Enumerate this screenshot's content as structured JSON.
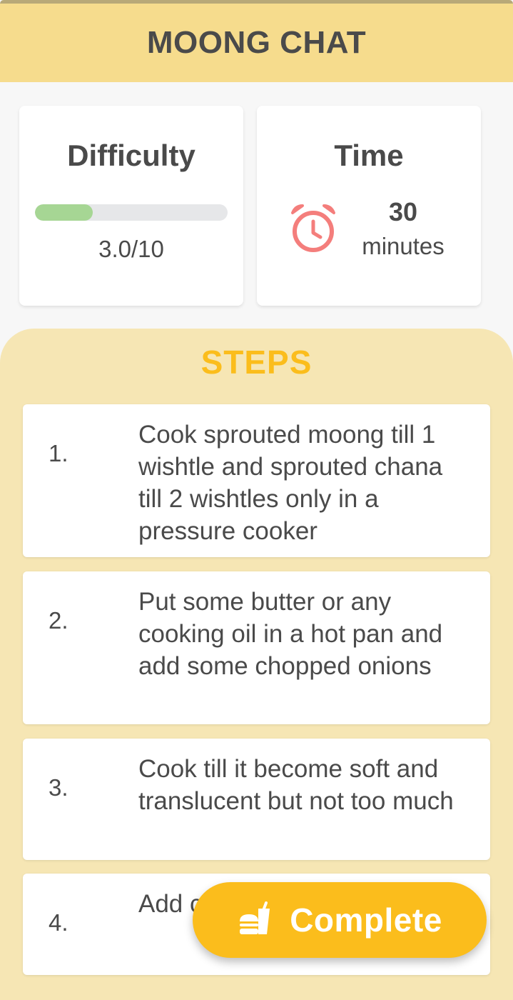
{
  "header": {
    "title": "MOONG CHAT"
  },
  "difficulty": {
    "title": "Difficulty",
    "value_text": "3.0/10",
    "progress": 0.3,
    "bar_color": "#a6d694"
  },
  "time": {
    "title": "Time",
    "value": "30",
    "unit": "minutes",
    "icon": "alarm-clock-icon",
    "icon_color": "#f47e7c"
  },
  "steps": {
    "title": "STEPS",
    "items": [
      {
        "number": "1.",
        "text": "Cook sprouted moong till 1 wishtle and sprouted chana till 2 wishtles only in a pressure cooker"
      },
      {
        "number": "2.",
        "text": "Put some butter or any cooking oil in a hot pan and add some  chopped onions"
      },
      {
        "number": "3.",
        "text": "Cook till it become soft and translucent but not too much"
      },
      {
        "number": "4.",
        "text": "Add chan"
      }
    ]
  },
  "complete_button": {
    "label": "Complete",
    "icon": "burger-drink-icon"
  },
  "colors": {
    "header_bg": "#f6dc8d",
    "steps_bg": "#f6e6b4",
    "accent": "#fbbd1c"
  }
}
